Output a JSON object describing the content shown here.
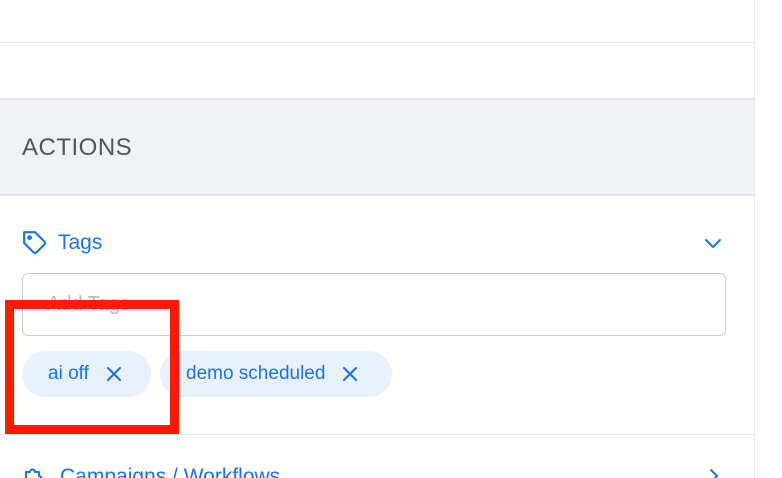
{
  "actions": {
    "title": "ACTIONS"
  },
  "tags_section": {
    "label": "Tags",
    "icon": "tag-icon",
    "expand_icon": "chevron-down-icon",
    "input_placeholder": "Add Tags",
    "chips": [
      {
        "label": "ai off",
        "remove_icon": "close-icon"
      },
      {
        "label": "demo scheduled",
        "remove_icon": "close-icon"
      }
    ]
  },
  "campaigns_section": {
    "label": "Campaigns / Workflows",
    "icon": "puzzle-icon",
    "expand_icon": "chevron-right-icon"
  },
  "colors": {
    "accent": "#1a73e8",
    "chip_bg": "#e8f1fd",
    "header_bg": "#f0f1f4",
    "annotation": "#ff1a00"
  }
}
